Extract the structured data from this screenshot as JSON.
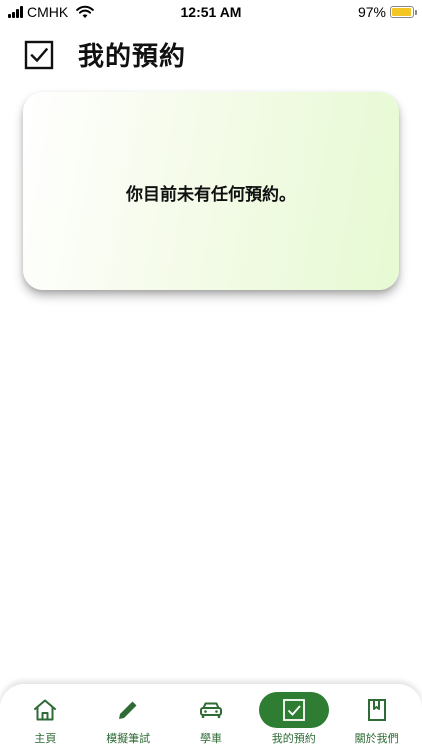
{
  "status_bar": {
    "carrier": "CMHK",
    "time": "12:51 AM",
    "battery_percent": "97%",
    "battery_level": 0.97,
    "battery_color": "#f3c623"
  },
  "header": {
    "icon": "checkbox-checked-icon",
    "title": "我的預約"
  },
  "empty_state": {
    "message": "你目前未有任何預約。"
  },
  "bottom_nav": {
    "accent_color": "#2e7d32",
    "items": [
      {
        "label": "主頁",
        "icon": "home-icon",
        "active": false
      },
      {
        "label": "模擬筆試",
        "icon": "pencil-icon",
        "active": false
      },
      {
        "label": "學車",
        "icon": "car-icon",
        "active": false
      },
      {
        "label": "我的預約",
        "icon": "checkbox-checked-icon",
        "active": true
      },
      {
        "label": "關於我們",
        "icon": "bookmark-book-icon",
        "active": false
      }
    ]
  }
}
